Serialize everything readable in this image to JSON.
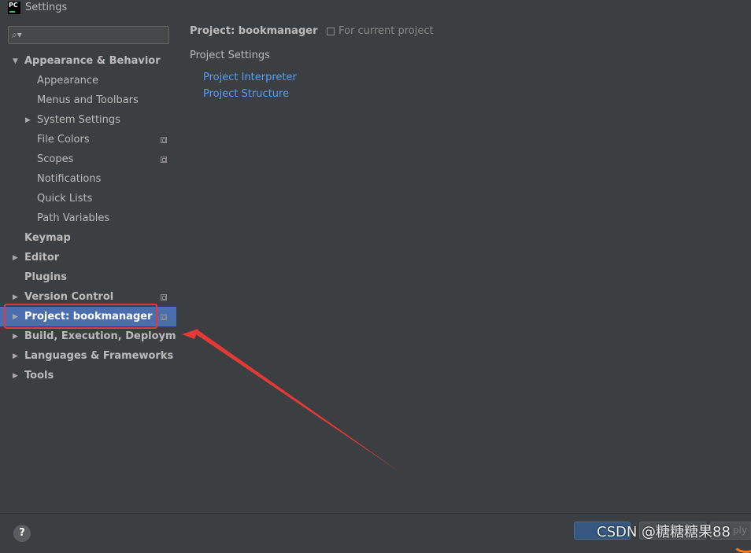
{
  "window": {
    "title": "Settings",
    "app_icon_text": "PC"
  },
  "search": {
    "placeholder": ""
  },
  "sidebar": {
    "items": [
      {
        "label": "Appearance & Behavior",
        "expanded": true
      },
      {
        "label": "Appearance"
      },
      {
        "label": "Menus and Toolbars"
      },
      {
        "label": "System Settings",
        "collapsed": true
      },
      {
        "label": "File Colors",
        "project_icon": true
      },
      {
        "label": "Scopes",
        "project_icon": true
      },
      {
        "label": "Notifications"
      },
      {
        "label": "Quick Lists"
      },
      {
        "label": "Path Variables"
      },
      {
        "label": "Keymap"
      },
      {
        "label": "Editor",
        "collapsed": true
      },
      {
        "label": "Plugins"
      },
      {
        "label": "Version Control",
        "collapsed": true,
        "project_icon": true
      },
      {
        "label": "Project: bookmanager",
        "collapsed": true,
        "project_icon": true,
        "selected": true
      },
      {
        "label": "Build, Execution, Deployment",
        "collapsed": true
      },
      {
        "label": "Languages & Frameworks",
        "collapsed": true
      },
      {
        "label": "Tools",
        "collapsed": true
      }
    ]
  },
  "content": {
    "title": "Project: bookmanager",
    "scope_note": "For current project",
    "section_heading": "Project Settings",
    "links": [
      "Project Interpreter",
      "Project Structure"
    ]
  },
  "footer": {
    "help_label": "?",
    "apply_label": "ply",
    "watermark": "CSDN @糖糖糖果88"
  },
  "colors": {
    "background": "#3c3f41",
    "selection": "#4b6eaf",
    "link": "#589df6",
    "annotation_red": "#e53935"
  }
}
